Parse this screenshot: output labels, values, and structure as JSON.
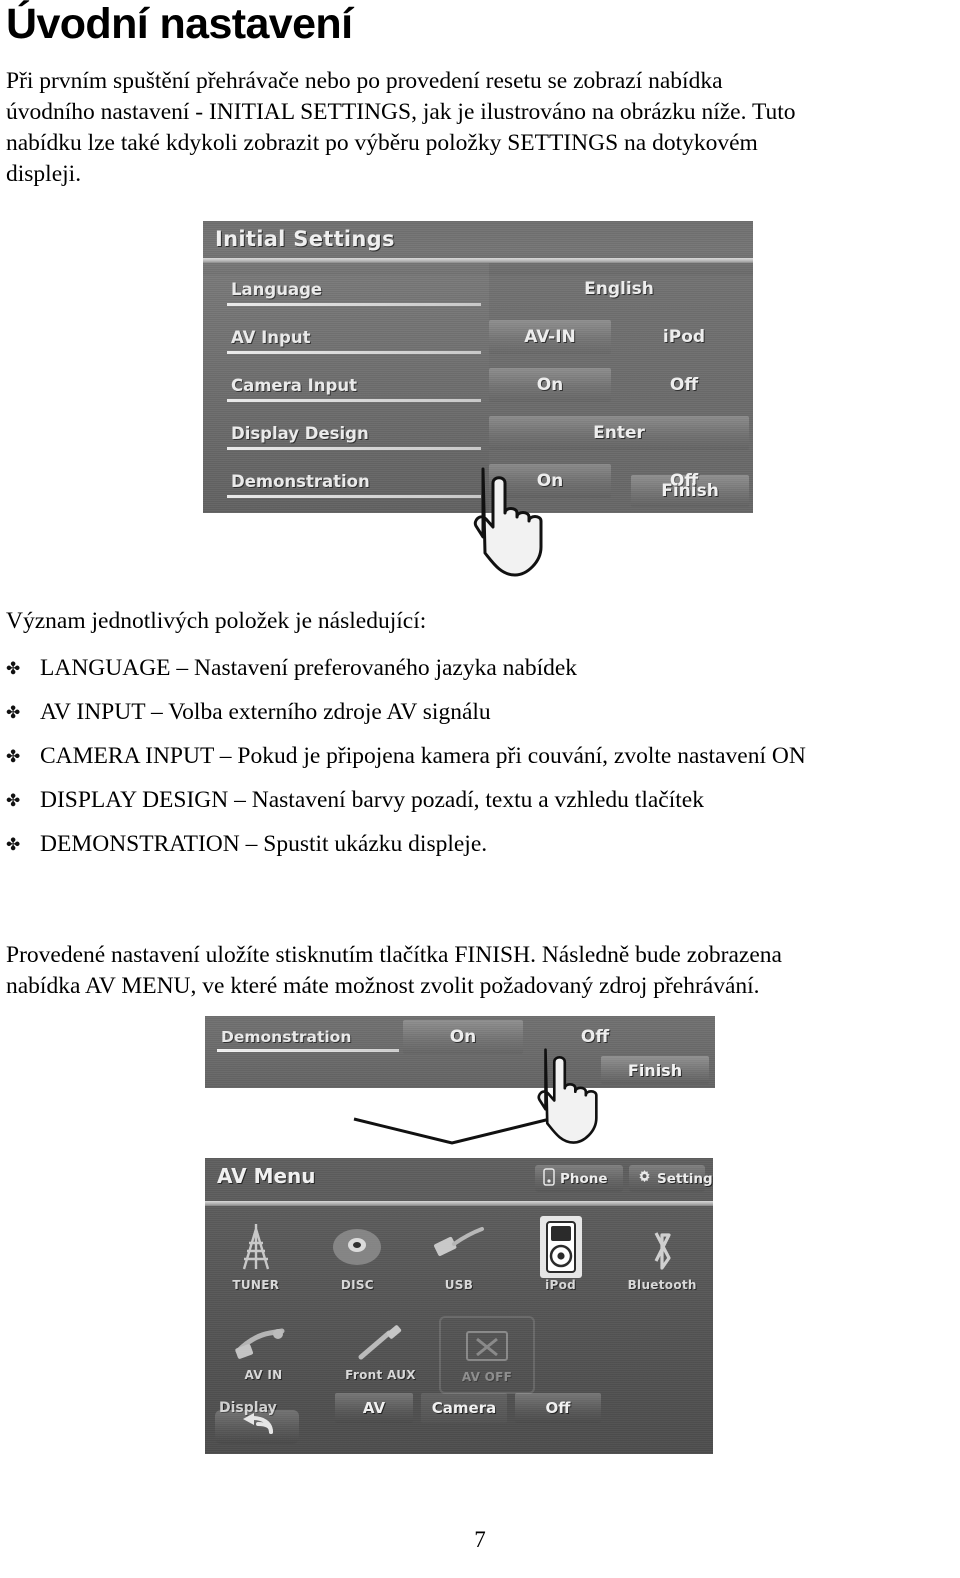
{
  "page": {
    "title": "Úvodní nastavení",
    "number": "7"
  },
  "intro": {
    "line1": "Při prvním spuštění přehrávače nebo po provedení resetu se zobrazí nabídka",
    "line2": "úvodního nastavení - INITIAL SETTINGS, jak je ilustrováno na obrázku níže. Tuto",
    "line3": "nabídku lze také kdykoli zobrazit po výběru položky SETTINGS na dotykovém",
    "line4": "displeji."
  },
  "list": {
    "lead_in": "Význam jednotlivých položek je následující:",
    "bullet_glyph": "✤",
    "items": [
      {
        "term": "LANGUAGE",
        "dash": "–",
        "desc": "Nastavení preferovaného jazyka nabídek"
      },
      {
        "term": "AV INPUT",
        "dash": "–",
        "desc": "Volba externího zdroje AV signálu"
      },
      {
        "term": "CAMERA INPUT",
        "dash": "–",
        "desc": "Pokud je připojena kamera při couvání, zvolte nastavení ON"
      },
      {
        "term": "DISPLAY DESIGN",
        "dash": "–",
        "desc": "Nastavení barvy pozadí, textu a vzhledu tlačítek"
      },
      {
        "term": "DEMONSTRATION",
        "dash": "–",
        "desc": " Spustit ukázku displeje."
      }
    ]
  },
  "outro": {
    "line1": "Provedené nastavení uložíte stisknutím tlačítka FINISH. Následně bude zobrazena",
    "line2": "nabídka AV MENU, ve které máte možnost zvolit požadovaný zdroj přehrávání."
  },
  "figure_initial_settings": {
    "screen_title": "Initial Settings",
    "rows": [
      {
        "label": "Language",
        "options": [
          {
            "text": "English",
            "style": "wide",
            "button": false
          }
        ]
      },
      {
        "label": "AV Input",
        "options": [
          {
            "text": "AV-IN",
            "style": "half",
            "button": true
          },
          {
            "text": "iPod",
            "style": "half",
            "button": false
          }
        ]
      },
      {
        "label": "Camera Input",
        "options": [
          {
            "text": "On",
            "style": "half",
            "button": true
          },
          {
            "text": "Off",
            "style": "half",
            "button": false
          }
        ]
      },
      {
        "label": "Display Design",
        "options": [
          {
            "text": "Enter",
            "style": "wide",
            "button": true
          }
        ]
      },
      {
        "label": "Demonstration",
        "options": [
          {
            "text": "On",
            "style": "half",
            "button": true
          },
          {
            "text": "Off",
            "style": "half",
            "button": false
          }
        ]
      }
    ],
    "finish_label": "Finish"
  },
  "figure_demonstration_strip": {
    "label": "Demonstration",
    "option_on": "On",
    "option_off": "Off",
    "finish_label": "Finish"
  },
  "figure_av_menu": {
    "screen_title": "AV Menu",
    "top_buttons": [
      {
        "label": "Phone",
        "icon": "phone-icon"
      },
      {
        "label": "Setting",
        "icon": "gear-icon"
      }
    ],
    "sources_row1": [
      {
        "label": "TUNER",
        "icon": "antenna-icon",
        "selected": false,
        "disabled": false
      },
      {
        "label": "DISC",
        "icon": "disc-icon",
        "selected": false,
        "disabled": false
      },
      {
        "label": "USB",
        "icon": "usb-icon",
        "selected": false,
        "disabled": false
      },
      {
        "label": "iPod",
        "icon": "ipod-icon",
        "selected": true,
        "disabled": false
      },
      {
        "label": "Bluetooth",
        "icon": "bluetooth-icon",
        "selected": false,
        "disabled": false
      }
    ],
    "sources_row2": [
      {
        "label": "AV IN",
        "icon": "av-in-icon",
        "selected": false,
        "disabled": false
      },
      {
        "label": "Front AUX",
        "icon": "aux-jack-icon",
        "selected": false,
        "disabled": false
      },
      {
        "label": "AV OFF",
        "icon": "av-off-icon",
        "selected": false,
        "disabled": true
      }
    ],
    "display_row": {
      "label": "Display",
      "buttons": [
        {
          "label": "AV",
          "active": true
        },
        {
          "label": "Camera",
          "active": false
        },
        {
          "label": "Off",
          "active": false
        }
      ]
    },
    "back_button_icon": "back-arrow-icon"
  },
  "colors": {
    "page_background": "#ffffff",
    "text": "#000000",
    "screen_grey_light": "#717171",
    "screen_grey_dark": "#4d4d4d",
    "screen_text": "#f0f0f0"
  }
}
